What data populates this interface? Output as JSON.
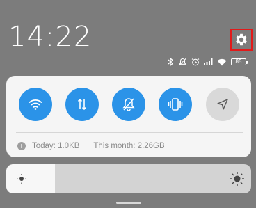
{
  "header": {
    "time": "14:22"
  },
  "status_icons": [
    "bluetooth-icon",
    "silent-icon",
    "alarm-icon",
    "signal-icon",
    "wifi-icon",
    "battery-icon"
  ],
  "battery": {
    "level_text": "85"
  },
  "toggles": [
    {
      "name": "wifi",
      "state": "on",
      "icon": "wifi-icon"
    },
    {
      "name": "mobile-data",
      "state": "on",
      "icon": "data-arrows-icon"
    },
    {
      "name": "silent",
      "state": "on",
      "icon": "bell-off-icon"
    },
    {
      "name": "vibrate",
      "state": "on",
      "icon": "vibrate-icon"
    },
    {
      "name": "location",
      "state": "off",
      "icon": "location-arrow-icon"
    }
  ],
  "data_usage": {
    "today": "Today: 1.0KB",
    "month": "This month: 2.26GB"
  },
  "brightness": {
    "level": 0.2
  },
  "colors": {
    "accent": "#2b93e8",
    "highlight": "#e21a1a",
    "background": "#7c7c7c"
  }
}
